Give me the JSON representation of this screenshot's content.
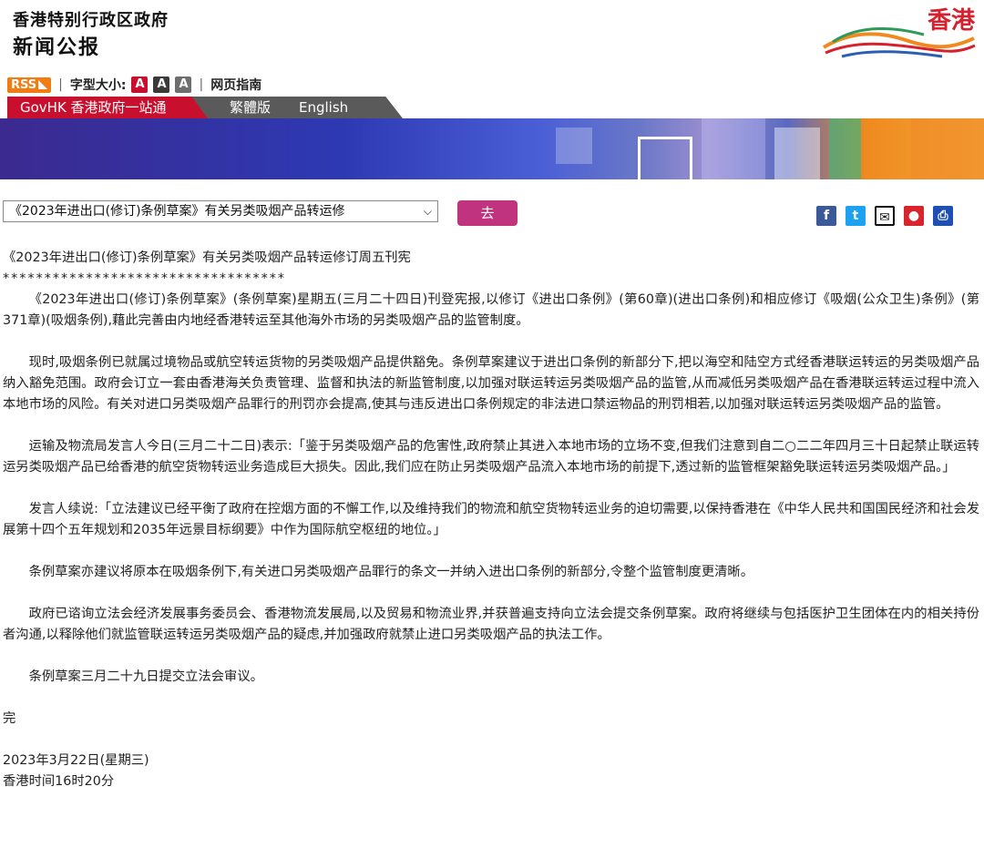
{
  "header": {
    "site_name": "香港特别行政区政府",
    "site_sub": "新闻公报",
    "logo_text": "香港"
  },
  "util": {
    "rss": "RSS",
    "font_size_label": "字型大小:",
    "font_a": "A",
    "web_guide": "网页指南"
  },
  "nav": {
    "govhk": "GovHK 香港政府一站通",
    "trad": "繁體版",
    "english": "English"
  },
  "controls": {
    "select_value": "《2023年进出口(修订)条例草案》有关另类吸烟产品转运修",
    "go": "去"
  },
  "article": {
    "title": "《2023年进出口(修订)条例草案》有关另类吸烟产品转运修订周五刊宪",
    "stars": "**********************************",
    "paragraphs": [
      "《2023年进出口(修订)条例草案》(条例草案)星期五(三月二十四日)刊登宪报,以修订《进出口条例》(第60章)(进出口条例)和相应修订《吸烟(公众卫生)条例》(第371章)(吸烟条例),藉此完善由内地经香港转运至其他海外市场的另类吸烟产品的监管制度。",
      "现时,吸烟条例已就属过境物品或航空转运货物的另类吸烟产品提供豁免。条例草案建议于进出口条例的新部分下,把以海空和陆空方式经香港联运转运的另类吸烟产品纳入豁免范围。政府会订立一套由香港海关负责管理、监督和执法的新监管制度,以加强对联运转运另类吸烟产品的监管,从而减低另类吸烟产品在香港联运转运过程中流入本地市场的风险。有关对进口另类吸烟产品罪行的刑罚亦会提高,使其与违反进出口条例规定的非法进口禁运物品的刑罚相若,以加强对联运转运另类吸烟产品的监管。",
      "运输及物流局发言人今日(三月二十二日)表示:「鉴于另类吸烟产品的危害性,政府禁止其进入本地市场的立场不变,但我们注意到自二○二二年四月三十日起禁止联运转运另类吸烟产品已给香港的航空货物转运业务造成巨大损失。因此,我们应在防止另类吸烟产品流入本地市场的前提下,透过新的监管框架豁免联运转运另类吸烟产品。」",
      "发言人续说:「立法建议已经平衡了政府在控烟方面的不懈工作,以及维持我们的物流和航空货物转运业务的迫切需要,以保持香港在《中华人民共和国国民经济和社会发展第十四个五年规划和2035年远景目标纲要》中作为国际航空枢纽的地位。」",
      "条例草案亦建议将原本在吸烟条例下,有关进口另类吸烟产品罪行的条文一并纳入进出口条例的新部分,令整个监管制度更清晰。",
      "政府已谘询立法会经济发展事务委员会、香港物流发展局,以及贸易和物流业界,并获普遍支持向立法会提交条例草案。政府将继续与包括医护卫生团体在内的相关持份者沟通,以释除他们就监管联运转运另类吸烟产品的疑虑,并加强政府就禁止进口另类吸烟产品的执法工作。",
      "条例草案三月二十九日提交立法会审议。"
    ],
    "end_mark": "完",
    "date": "2023年3月22日(星期三)",
    "time": "香港时间16时20分"
  },
  "colors": {
    "accent_red": "#c8102e",
    "go_button": "#c0337e",
    "rss_orange": "#f07c13"
  }
}
